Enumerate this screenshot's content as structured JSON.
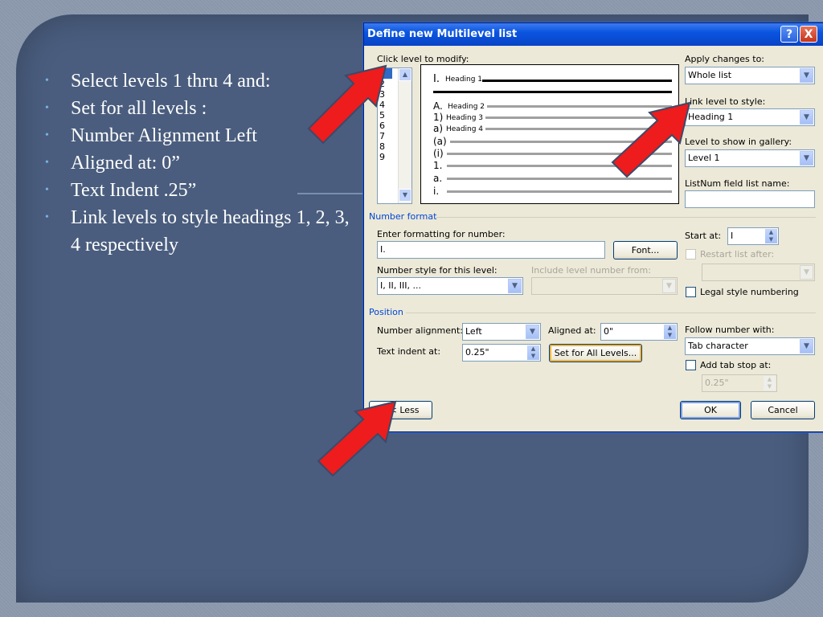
{
  "slide": {
    "bullets": [
      "Select levels 1 thru 4 and:",
      "Set for all levels :",
      "Number Alignment Left",
      "Aligned at: 0”",
      "Text Indent .25”",
      "Link  levels to style headings 1, 2, 3, 4 respectively"
    ]
  },
  "dialog": {
    "title": "Define new Multilevel list",
    "help_button": "?",
    "close_button": "X",
    "click_level_label": "Click level to modify:",
    "levels": [
      "1",
      "2",
      "3",
      "4",
      "5",
      "6",
      "7",
      "8",
      "9"
    ],
    "selected_level": "1",
    "preview": [
      {
        "marker": "I.",
        "text": "Heading 1"
      },
      {
        "marker": "A.",
        "text": "Heading 2"
      },
      {
        "marker": "1)",
        "text": "Heading 3"
      },
      {
        "marker": "a)",
        "text": "Heading 4"
      },
      {
        "marker": "(a)",
        "text": ""
      },
      {
        "marker": "(i)",
        "text": ""
      },
      {
        "marker": "1.",
        "text": ""
      },
      {
        "marker": "a.",
        "text": ""
      },
      {
        "marker": "i.",
        "text": ""
      }
    ],
    "apply_changes_label": "Apply changes to:",
    "apply_changes_value": "Whole list",
    "link_level_label": "Link level to style:",
    "link_level_value": "Heading 1",
    "gallery_label": "Level to show in gallery:",
    "gallery_value": "Level 1",
    "listnum_label": "ListNum field list name:",
    "listnum_value": "",
    "number_format_section": "Number format",
    "enter_formatting_label": "Enter formatting for number:",
    "formatting_value": "I.",
    "font_button": "Font...",
    "number_style_label": "Number style for this level:",
    "number_style_value": "I, II, III, ...",
    "include_level_label": "Include level number from:",
    "include_level_value": "",
    "start_at_label": "Start at:",
    "start_at_value": "I",
    "restart_label": "Restart list after:",
    "restart_value": "",
    "legal_style_label": "Legal style numbering",
    "position_section": "Position",
    "number_alignment_label": "Number alignment:",
    "number_alignment_value": "Left",
    "aligned_at_label": "Aligned at:",
    "aligned_at_value": "0\"",
    "text_indent_label": "Text indent at:",
    "text_indent_value": "0.25\"",
    "set_all_levels_button": "Set for All Levels...",
    "follow_number_label": "Follow number with:",
    "follow_number_value": "Tab character",
    "add_tab_label": "Add tab stop at:",
    "tab_stop_value": "0.25\"",
    "less_button": "<< Less",
    "ok_button": "OK",
    "cancel_button": "Cancel"
  },
  "colors": {
    "slide_bg": "#4a5d7e",
    "title_bar": "#0a55e0",
    "callout_arrow": "#ee1c1c",
    "section_heading": "#0046d5"
  }
}
